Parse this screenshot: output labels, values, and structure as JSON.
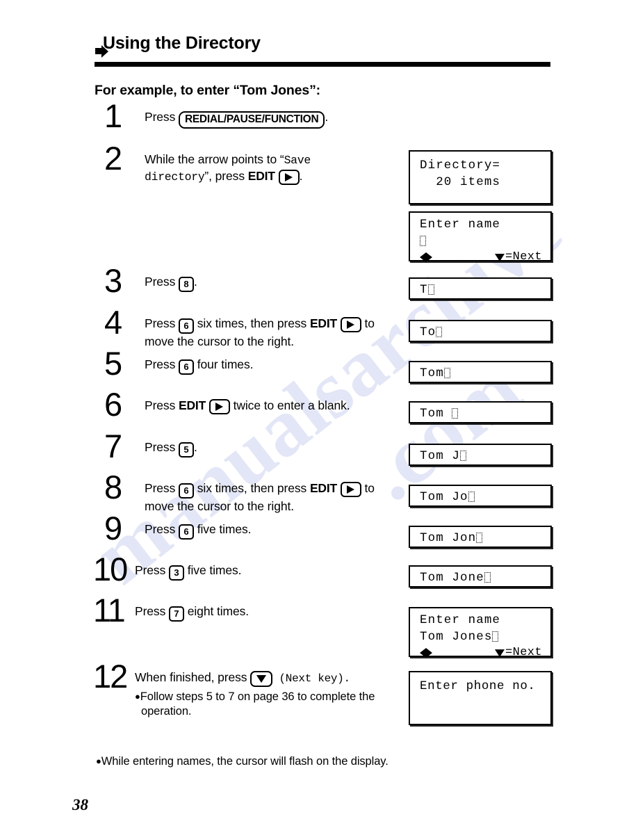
{
  "header": {
    "arrow_icon": "right-arrow-bullet",
    "section_title": "Using the Directory",
    "example_heading": "For example, to enter “Tom Jones”:"
  },
  "steps": [
    {
      "number": "1",
      "text_before": "Press ",
      "key": "REDIAL/PAUSE/FUNCTION",
      "text_after": "."
    },
    {
      "number": "2",
      "line1_before": "While the arrow points to “",
      "mono1": "Save",
      "mono2": "directory",
      "line2_after": "”, press ",
      "bold_key": "EDIT",
      "text_end": "."
    },
    {
      "number": "3",
      "text_before": "Press ",
      "key": "8",
      "text_after": "."
    },
    {
      "number": "4",
      "text_before": "Press ",
      "key": "6",
      "text_mid": " six times, then press ",
      "bold_key": "EDIT",
      "text_after": " to move the cursor to the right."
    },
    {
      "number": "5",
      "text_before": "Press ",
      "key": "6",
      "text_after": " four times."
    },
    {
      "number": "6",
      "text_before": "Press ",
      "bold_key": "EDIT",
      "text_after": " twice to enter a blank."
    },
    {
      "number": "7",
      "text_before": "Press ",
      "key": "5",
      "text_after": "."
    },
    {
      "number": "8",
      "text_before": "Press ",
      "key": "6",
      "text_mid": " six times, then press ",
      "bold_key": "EDIT",
      "text_after": " to move the cursor to the right."
    },
    {
      "number": "9",
      "text_before": "Press ",
      "key": "6",
      "text_after": " five times."
    },
    {
      "number": "10",
      "text_before": "Press ",
      "key": "3",
      "text_after": " five times."
    },
    {
      "number": "11",
      "text_before": "Press ",
      "key": "7",
      "text_after": " eight times."
    },
    {
      "number": "12",
      "text_before": "When finished, press ",
      "key_icon": "down-arrow-key",
      "text_after": " (Next key).",
      "bullet": "●",
      "sub_note": "Follow steps 5 to 7 on page 36 to complete the operation."
    }
  ],
  "displays": [
    {
      "id": "display-directory-count",
      "type": "two-line",
      "line1": "Directory=",
      "line2": "  20 items"
    },
    {
      "id": "display-enter-name-empty",
      "type": "three-line-nav",
      "line1": "Enter name",
      "line2": "",
      "nav_left_right": "◀▶",
      "next_label": "=Next",
      "next_icon": "down-triangle-icon"
    },
    {
      "id": "display-t",
      "type": "one-line",
      "line1": "T"
    },
    {
      "id": "display-to",
      "type": "one-line",
      "line1": "To"
    },
    {
      "id": "display-tom",
      "type": "one-line",
      "line1": "Tom"
    },
    {
      "id": "display-tom-blank",
      "type": "one-line",
      "line1": "Tom "
    },
    {
      "id": "display-tom-j",
      "type": "one-line",
      "line1": "Tom J"
    },
    {
      "id": "display-tom-jo",
      "type": "one-line",
      "line1": "Tom Jo"
    },
    {
      "id": "display-tom-jon",
      "type": "one-line",
      "line1": "Tom Jon"
    },
    {
      "id": "display-tom-jone",
      "type": "one-line",
      "line1": "Tom Jone"
    },
    {
      "id": "display-enter-name-full",
      "type": "three-line-nav",
      "line1": "Enter name",
      "line2": "Tom Jones",
      "nav_left_right": "◀▶",
      "next_label": "=Next",
      "next_icon": "down-triangle-icon"
    },
    {
      "id": "display-enter-phone",
      "type": "two-line",
      "line1": "Enter phone no.",
      "line2": ""
    }
  ],
  "footnote": {
    "bullet": "●",
    "text": "While entering names, the cursor will flash on the display."
  },
  "page_number": "38",
  "watermark": {
    "text_a": "manualsarchive",
    "text_b": ".com"
  },
  "colors": {
    "ink": "#000000",
    "paper": "#ffffff",
    "watermark": "#cdd2ef"
  }
}
